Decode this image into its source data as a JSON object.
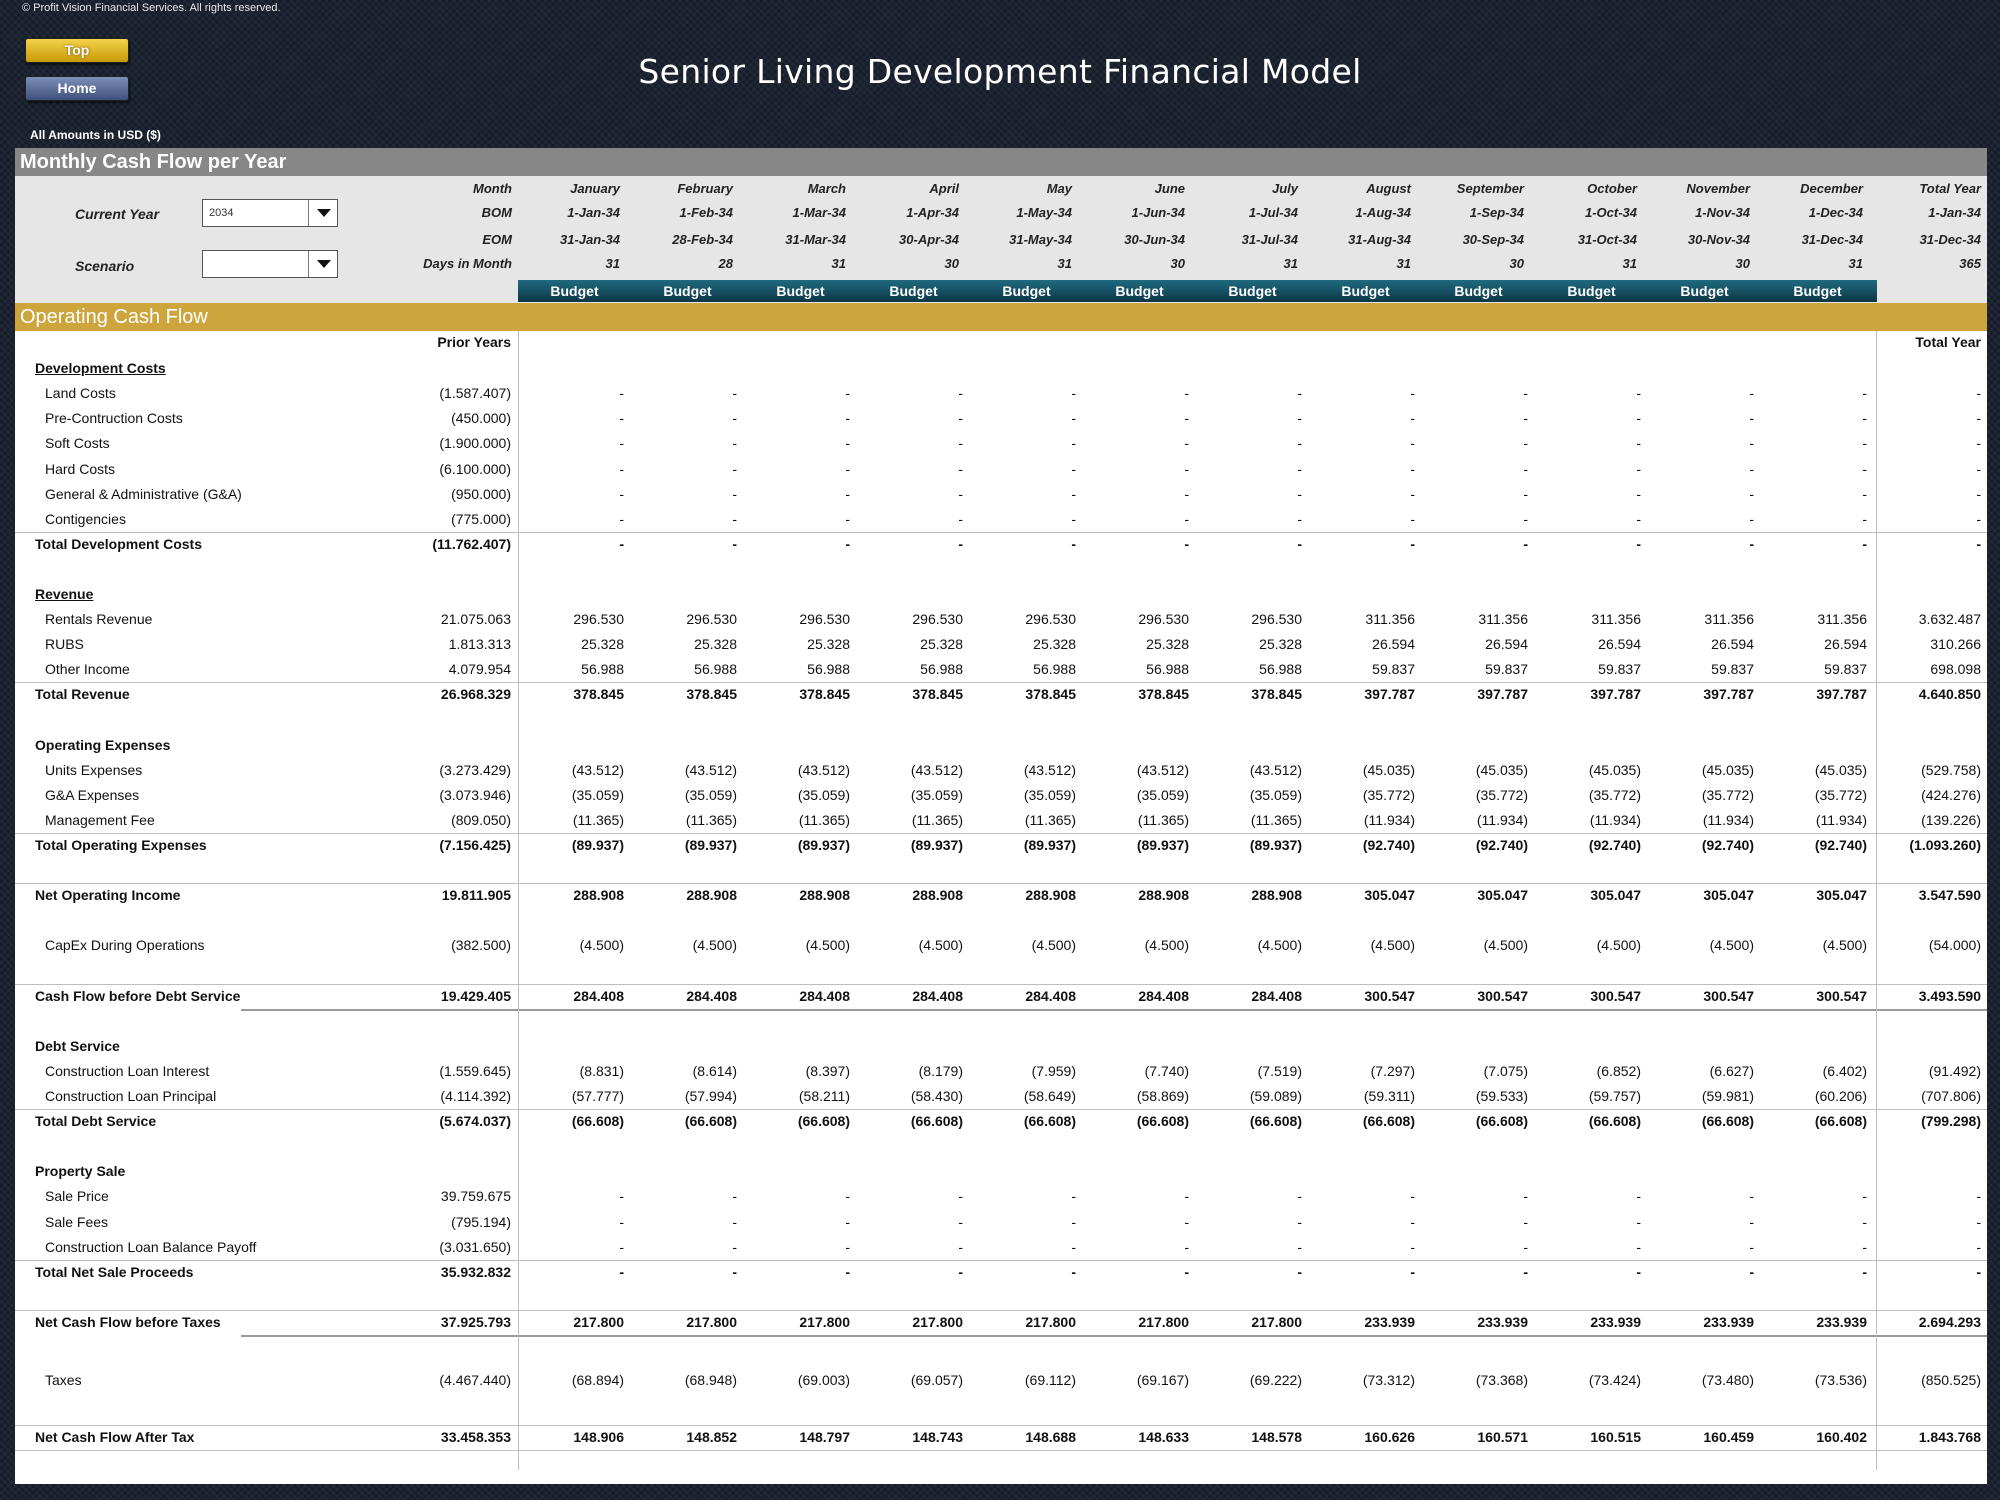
{
  "copyright": "© Profit Vision Financial Services. All rights reserved.",
  "nav": {
    "top_label": "Top",
    "home_label": "Home"
  },
  "title": "Senior Living Development Financial Model",
  "currency_note": "All Amounts in  USD ($)",
  "section_title": "Monthly Cash Flow per Year",
  "controls": {
    "current_year_label": "Current Year",
    "current_year_value": "2034",
    "scenario_label": "Scenario",
    "scenario_value": ""
  },
  "header": {
    "row_labels": [
      "Month",
      "BOM",
      "EOM",
      "Days in Month"
    ],
    "months": [
      {
        "name": "January",
        "bom": "1-Jan-34",
        "eom": "31-Jan-34",
        "days": "31",
        "scenario": "Budget"
      },
      {
        "name": "February",
        "bom": "1-Feb-34",
        "eom": "28-Feb-34",
        "days": "28",
        "scenario": "Budget"
      },
      {
        "name": "March",
        "bom": "1-Mar-34",
        "eom": "31-Mar-34",
        "days": "31",
        "scenario": "Budget"
      },
      {
        "name": "April",
        "bom": "1-Apr-34",
        "eom": "30-Apr-34",
        "days": "30",
        "scenario": "Budget"
      },
      {
        "name": "May",
        "bom": "1-May-34",
        "eom": "31-May-34",
        "days": "31",
        "scenario": "Budget"
      },
      {
        "name": "June",
        "bom": "1-Jun-34",
        "eom": "30-Jun-34",
        "days": "30",
        "scenario": "Budget"
      },
      {
        "name": "July",
        "bom": "1-Jul-34",
        "eom": "31-Jul-34",
        "days": "31",
        "scenario": "Budget"
      },
      {
        "name": "August",
        "bom": "1-Aug-34",
        "eom": "31-Aug-34",
        "days": "31",
        "scenario": "Budget"
      },
      {
        "name": "September",
        "bom": "1-Sep-34",
        "eom": "30-Sep-34",
        "days": "30",
        "scenario": "Budget"
      },
      {
        "name": "October",
        "bom": "1-Oct-34",
        "eom": "31-Oct-34",
        "days": "31",
        "scenario": "Budget"
      },
      {
        "name": "November",
        "bom": "1-Nov-34",
        "eom": "30-Nov-34",
        "days": "30",
        "scenario": "Budget"
      },
      {
        "name": "December",
        "bom": "1-Dec-34",
        "eom": "31-Dec-34",
        "days": "31",
        "scenario": "Budget"
      }
    ],
    "total": {
      "name": "Total Year",
      "bom": "1-Jan-34",
      "eom": "31-Dec-34",
      "days": "365"
    }
  },
  "ocf_title": "Operating Cash Flow",
  "col_headers": {
    "prior": "Prior Years",
    "total": "Total Year"
  },
  "rows": [
    {
      "label": "Development Costs",
      "type": "heading-ul"
    },
    {
      "label": "Land Costs",
      "type": "item",
      "prior": "(1.587.407)",
      "m": [
        "-",
        "-",
        "-",
        "-",
        "-",
        "-",
        "-",
        "-",
        "-",
        "-",
        "-",
        "-"
      ],
      "total": "-"
    },
    {
      "label": "Pre-Contruction Costs",
      "type": "item",
      "prior": "(450.000)",
      "m": [
        "-",
        "-",
        "-",
        "-",
        "-",
        "-",
        "-",
        "-",
        "-",
        "-",
        "-",
        "-"
      ],
      "total": "-"
    },
    {
      "label": "Soft Costs",
      "type": "item",
      "prior": "(1.900.000)",
      "m": [
        "-",
        "-",
        "-",
        "-",
        "-",
        "-",
        "-",
        "-",
        "-",
        "-",
        "-",
        "-"
      ],
      "total": "-"
    },
    {
      "label": "Hard Costs",
      "type": "item",
      "prior": "(6.100.000)",
      "m": [
        "-",
        "-",
        "-",
        "-",
        "-",
        "-",
        "-",
        "-",
        "-",
        "-",
        "-",
        "-"
      ],
      "total": "-"
    },
    {
      "label": "General & Administrative (G&A)",
      "type": "item",
      "prior": "(950.000)",
      "m": [
        "-",
        "-",
        "-",
        "-",
        "-",
        "-",
        "-",
        "-",
        "-",
        "-",
        "-",
        "-"
      ],
      "total": "-"
    },
    {
      "label": "Contigencies",
      "type": "item",
      "prior": "(775.000)",
      "m": [
        "-",
        "-",
        "-",
        "-",
        "-",
        "-",
        "-",
        "-",
        "-",
        "-",
        "-",
        "-"
      ],
      "total": "-",
      "line_below": true
    },
    {
      "label": "Total Development Costs",
      "type": "total",
      "prior": "(11.762.407)",
      "m": [
        "-",
        "-",
        "-",
        "-",
        "-",
        "-",
        "-",
        "-",
        "-",
        "-",
        "-",
        "-"
      ],
      "total": "-"
    },
    {
      "type": "blank"
    },
    {
      "label": "Revenue",
      "type": "heading-ul"
    },
    {
      "label": "Rentals Revenue",
      "type": "item",
      "prior": "21.075.063",
      "m": [
        "296.530",
        "296.530",
        "296.530",
        "296.530",
        "296.530",
        "296.530",
        "296.530",
        "311.356",
        "311.356",
        "311.356",
        "311.356",
        "311.356"
      ],
      "total": "3.632.487"
    },
    {
      "label": "RUBS",
      "type": "item",
      "prior": "1.813.313",
      "m": [
        "25.328",
        "25.328",
        "25.328",
        "25.328",
        "25.328",
        "25.328",
        "25.328",
        "26.594",
        "26.594",
        "26.594",
        "26.594",
        "26.594"
      ],
      "total": "310.266"
    },
    {
      "label": "Other Income",
      "type": "item",
      "prior": "4.079.954",
      "m": [
        "56.988",
        "56.988",
        "56.988",
        "56.988",
        "56.988",
        "56.988",
        "56.988",
        "59.837",
        "59.837",
        "59.837",
        "59.837",
        "59.837"
      ],
      "total": "698.098",
      "line_below": true
    },
    {
      "label": "Total Revenue",
      "type": "total",
      "prior": "26.968.329",
      "m": [
        "378.845",
        "378.845",
        "378.845",
        "378.845",
        "378.845",
        "378.845",
        "378.845",
        "397.787",
        "397.787",
        "397.787",
        "397.787",
        "397.787"
      ],
      "total": "4.640.850"
    },
    {
      "type": "blank"
    },
    {
      "label": "Operating Expenses",
      "type": "heading"
    },
    {
      "label": "Units Expenses",
      "type": "item",
      "prior": "(3.273.429)",
      "m": [
        "(43.512)",
        "(43.512)",
        "(43.512)",
        "(43.512)",
        "(43.512)",
        "(43.512)",
        "(43.512)",
        "(45.035)",
        "(45.035)",
        "(45.035)",
        "(45.035)",
        "(45.035)"
      ],
      "total": "(529.758)"
    },
    {
      "label": "G&A Expenses",
      "type": "item",
      "prior": "(3.073.946)",
      "m": [
        "(35.059)",
        "(35.059)",
        "(35.059)",
        "(35.059)",
        "(35.059)",
        "(35.059)",
        "(35.059)",
        "(35.772)",
        "(35.772)",
        "(35.772)",
        "(35.772)",
        "(35.772)"
      ],
      "total": "(424.276)"
    },
    {
      "label": "Management Fee",
      "type": "item",
      "prior": "(809.050)",
      "m": [
        "(11.365)",
        "(11.365)",
        "(11.365)",
        "(11.365)",
        "(11.365)",
        "(11.365)",
        "(11.365)",
        "(11.934)",
        "(11.934)",
        "(11.934)",
        "(11.934)",
        "(11.934)"
      ],
      "total": "(139.226)",
      "line_below": true
    },
    {
      "label": "Total Operating Expenses",
      "type": "total",
      "prior": "(7.156.425)",
      "m": [
        "(89.937)",
        "(89.937)",
        "(89.937)",
        "(89.937)",
        "(89.937)",
        "(89.937)",
        "(89.937)",
        "(92.740)",
        "(92.740)",
        "(92.740)",
        "(92.740)",
        "(92.740)"
      ],
      "total": "(1.093.260)"
    },
    {
      "type": "blank",
      "line_below": true
    },
    {
      "label": "Net Operating Income",
      "type": "total",
      "prior": "19.811.905",
      "m": [
        "288.908",
        "288.908",
        "288.908",
        "288.908",
        "288.908",
        "288.908",
        "288.908",
        "305.047",
        "305.047",
        "305.047",
        "305.047",
        "305.047"
      ],
      "total": "3.547.590"
    },
    {
      "type": "blank"
    },
    {
      "label": "CapEx During Operations",
      "type": "item",
      "prior": "(382.500)",
      "m": [
        "(4.500)",
        "(4.500)",
        "(4.500)",
        "(4.500)",
        "(4.500)",
        "(4.500)",
        "(4.500)",
        "(4.500)",
        "(4.500)",
        "(4.500)",
        "(4.500)",
        "(4.500)"
      ],
      "total": "(54.000)"
    },
    {
      "type": "blank",
      "line_below": true
    },
    {
      "label": "Cash Flow before Debt Service",
      "type": "total",
      "prior": "19.429.405",
      "m": [
        "284.408",
        "284.408",
        "284.408",
        "284.408",
        "284.408",
        "284.408",
        "284.408",
        "300.547",
        "300.547",
        "300.547",
        "300.547",
        "300.547"
      ],
      "total": "3.493.590",
      "dark_below": true
    },
    {
      "type": "blank"
    },
    {
      "label": "Debt Service",
      "type": "heading"
    },
    {
      "label": "Construction Loan Interest",
      "type": "item",
      "prior": "(1.559.645)",
      "m": [
        "(8.831)",
        "(8.614)",
        "(8.397)",
        "(8.179)",
        "(7.959)",
        "(7.740)",
        "(7.519)",
        "(7.297)",
        "(7.075)",
        "(6.852)",
        "(6.627)",
        "(6.402)"
      ],
      "total": "(91.492)"
    },
    {
      "label": "Construction Loan Principal",
      "type": "item",
      "prior": "(4.114.392)",
      "m": [
        "(57.777)",
        "(57.994)",
        "(58.211)",
        "(58.430)",
        "(58.649)",
        "(58.869)",
        "(59.089)",
        "(59.311)",
        "(59.533)",
        "(59.757)",
        "(59.981)",
        "(60.206)"
      ],
      "total": "(707.806)",
      "line_below": true
    },
    {
      "label": "Total Debt Service",
      "type": "total",
      "prior": "(5.674.037)",
      "m": [
        "(66.608)",
        "(66.608)",
        "(66.608)",
        "(66.608)",
        "(66.608)",
        "(66.608)",
        "(66.608)",
        "(66.608)",
        "(66.608)",
        "(66.608)",
        "(66.608)",
        "(66.608)"
      ],
      "total": "(799.298)"
    },
    {
      "type": "blank"
    },
    {
      "label": "Property Sale",
      "type": "heading"
    },
    {
      "label": "Sale Price",
      "type": "item",
      "prior": "39.759.675",
      "m": [
        "-",
        "-",
        "-",
        "-",
        "-",
        "-",
        "-",
        "-",
        "-",
        "-",
        "-",
        "-"
      ],
      "total": "-"
    },
    {
      "label": "Sale Fees",
      "type": "item",
      "prior": "(795.194)",
      "m": [
        "-",
        "-",
        "-",
        "-",
        "-",
        "-",
        "-",
        "-",
        "-",
        "-",
        "-",
        "-"
      ],
      "total": "-"
    },
    {
      "label": "Construction Loan Balance Payoff",
      "type": "item",
      "prior": "(3.031.650)",
      "m": [
        "-",
        "-",
        "-",
        "-",
        "-",
        "-",
        "-",
        "-",
        "-",
        "-",
        "-",
        "-"
      ],
      "total": "-",
      "line_below": true
    },
    {
      "label": "Total Net Sale Proceeds",
      "type": "total",
      "prior": "35.932.832",
      "m": [
        "-",
        "-",
        "-",
        "-",
        "-",
        "-",
        "-",
        "-",
        "-",
        "-",
        "-",
        "-"
      ],
      "total": "-"
    },
    {
      "type": "blank",
      "line_below": true
    },
    {
      "label": "Net Cash Flow before Taxes",
      "type": "total",
      "prior": "37.925.793",
      "m": [
        "217.800",
        "217.800",
        "217.800",
        "217.800",
        "217.800",
        "217.800",
        "217.800",
        "233.939",
        "233.939",
        "233.939",
        "233.939",
        "233.939"
      ],
      "total": "2.694.293",
      "dark_below": true
    },
    {
      "type": "blank"
    },
    {
      "label": "Taxes",
      "type": "item",
      "prior": "(4.467.440)",
      "m": [
        "(68.894)",
        "(68.948)",
        "(69.003)",
        "(69.057)",
        "(69.112)",
        "(69.167)",
        "(69.222)",
        "(73.312)",
        "(73.368)",
        "(73.424)",
        "(73.480)",
        "(73.536)"
      ],
      "total": "(850.525)",
      "tall": true
    },
    {
      "type": "blank",
      "line_below": true
    },
    {
      "label": "Net Cash Flow After Tax",
      "type": "total",
      "prior": "33.458.353",
      "m": [
        "148.906",
        "148.852",
        "148.797",
        "148.743",
        "148.688",
        "148.633",
        "148.578",
        "160.626",
        "160.571",
        "160.515",
        "160.459",
        "160.402"
      ],
      "total": "1.843.768",
      "line_below": true
    }
  ],
  "colors": {
    "gold": "#cda53c",
    "gray_bar": "#878787",
    "teal": "#1f6a80",
    "bg": "#1b2230"
  }
}
